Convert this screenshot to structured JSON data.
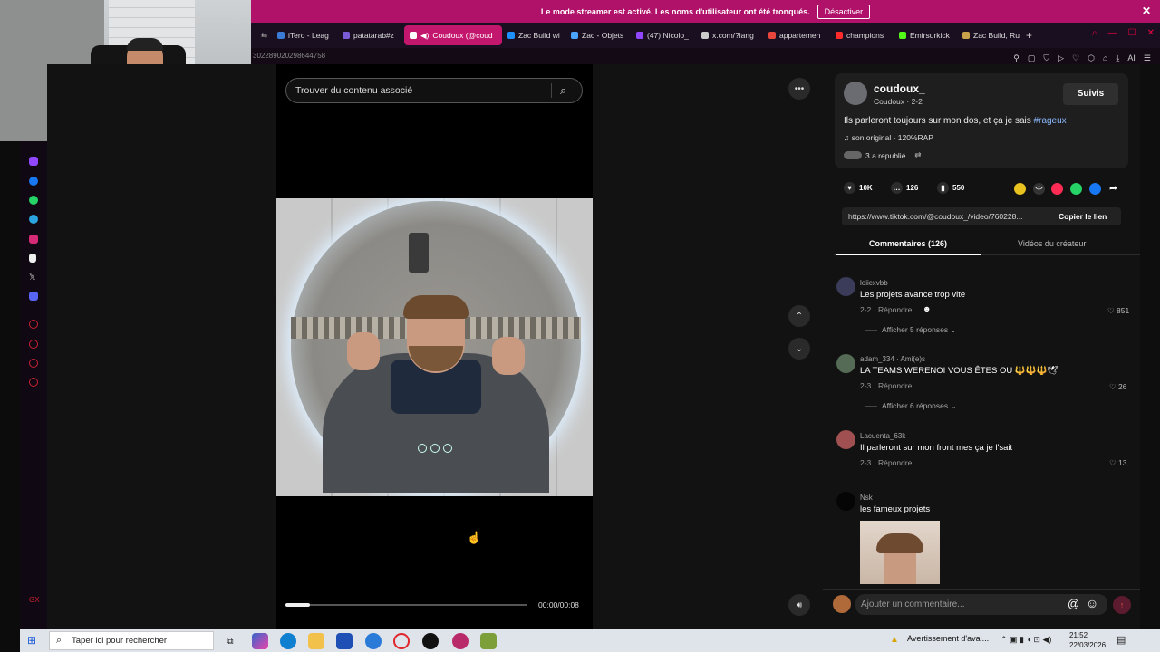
{
  "streamer_bar": {
    "message": "Le mode streamer est activé. Les noms d'utilisateur ont été tronqués.",
    "button": "Désactiver",
    "close": "✕"
  },
  "tabs": [
    {
      "label": "iTero - Leag",
      "color": "#3a7bd5"
    },
    {
      "label": "patatarab#z",
      "color": "#7b5cd6"
    },
    {
      "label": "Coudoux (@coud",
      "color": "#ffffff",
      "active": true
    },
    {
      "label": "Zac Build wi",
      "color": "#1e90ff"
    },
    {
      "label": "Zac - Objets",
      "color": "#4aa3ff"
    },
    {
      "label": "(47) Nicolo_",
      "color": "#9146ff"
    },
    {
      "label": "x.com/?lang",
      "color": "#cccccc"
    },
    {
      "label": "appartemen",
      "color": "#e8463c"
    },
    {
      "label": "champions",
      "color": "#ff2a2a"
    },
    {
      "label": "Emirsurkick",
      "color": "#53fc18"
    },
    {
      "label": "Zac Build, Ru",
      "color": "#c8a24a"
    }
  ],
  "address_bar": {
    "text": "302289020298644758"
  },
  "search": {
    "placeholder": "Trouver du contenu associé",
    "icon": "search-icon"
  },
  "video": {
    "time": "00:00/00:08",
    "progress": 0.1
  },
  "post": {
    "username": "coudoux_",
    "subtitle": "Coudoux · 2-2",
    "follow": "Suivis",
    "caption": "Ils parleront toujours sur mon dos, et ça je sais",
    "hashtag": "#rageux",
    "sound": "♫  son original - 120%RAP",
    "reposted": "3 a republié",
    "likes": "10K",
    "comments": "126",
    "saves": "550",
    "link": "https://www.tiktok.com/@coudoux_/video/760228...",
    "copy_link": "Copier le lien"
  },
  "panel_tabs": {
    "comments": "Commentaires (126)",
    "creator": "Vidéos du créateur"
  },
  "comments": [
    {
      "name": "loiicxvbb",
      "text": "Les projets avance trop vite",
      "date": "2-2",
      "reply": "Répondre",
      "likes": "851",
      "more": "Afficher 5 réponses",
      "avatar": "#3b3b5a"
    },
    {
      "name": "adam_334 · Ami(e)s",
      "text": "LA TEAMS WERENOI VOUS ÊTES OU 🔱🔱🔱🕊",
      "date": "2-3",
      "reply": "Répondre",
      "likes": "26",
      "more": "Afficher 6 réponses",
      "avatar": "#556b55"
    },
    {
      "name": "Lacuenta_63k",
      "text": "Il parleront sur mon front mes ça je l'sait",
      "date": "2-3",
      "reply": "Répondre",
      "likes": "13",
      "avatar": "#a05050"
    },
    {
      "name": "Nsk",
      "text": "les fameux projets",
      "avatar": "#050505"
    }
  ],
  "comment_bar": {
    "placeholder": "Ajouter un commentaire...",
    "at": "@",
    "emoji": "☺",
    "send": "↑"
  },
  "taskbar": {
    "search": "Taper ici pour rechercher",
    "warning": "Avertissement d'aval...",
    "time": "21:52",
    "date": "22/03/2026"
  },
  "colors": {
    "accent": "#c3176d",
    "streamer": "#b0126a",
    "panel": "#121212"
  }
}
